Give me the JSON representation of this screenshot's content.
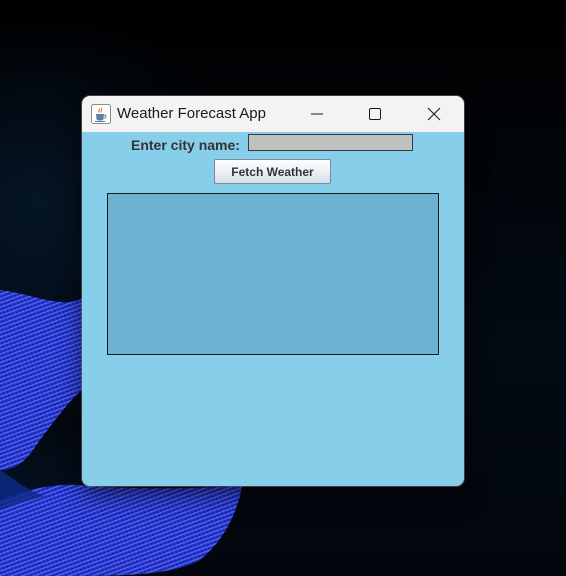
{
  "window": {
    "title": "Weather Forecast App",
    "app_icon": "java-cup-icon"
  },
  "titlebar_buttons": {
    "minimize_icon": "minimize-icon",
    "maximize_icon": "maximize-icon",
    "close_icon": "close-icon"
  },
  "form": {
    "city_label": "Enter city name:",
    "city_value": "",
    "city_placeholder": "",
    "fetch_button_label": "Fetch Weather"
  },
  "output": {
    "text": ""
  },
  "colors": {
    "content_background": "#87ceeb",
    "output_background": "#6cb3d2",
    "input_background": "#c0c0c0",
    "titlebar_background": "#f3f3f3"
  }
}
